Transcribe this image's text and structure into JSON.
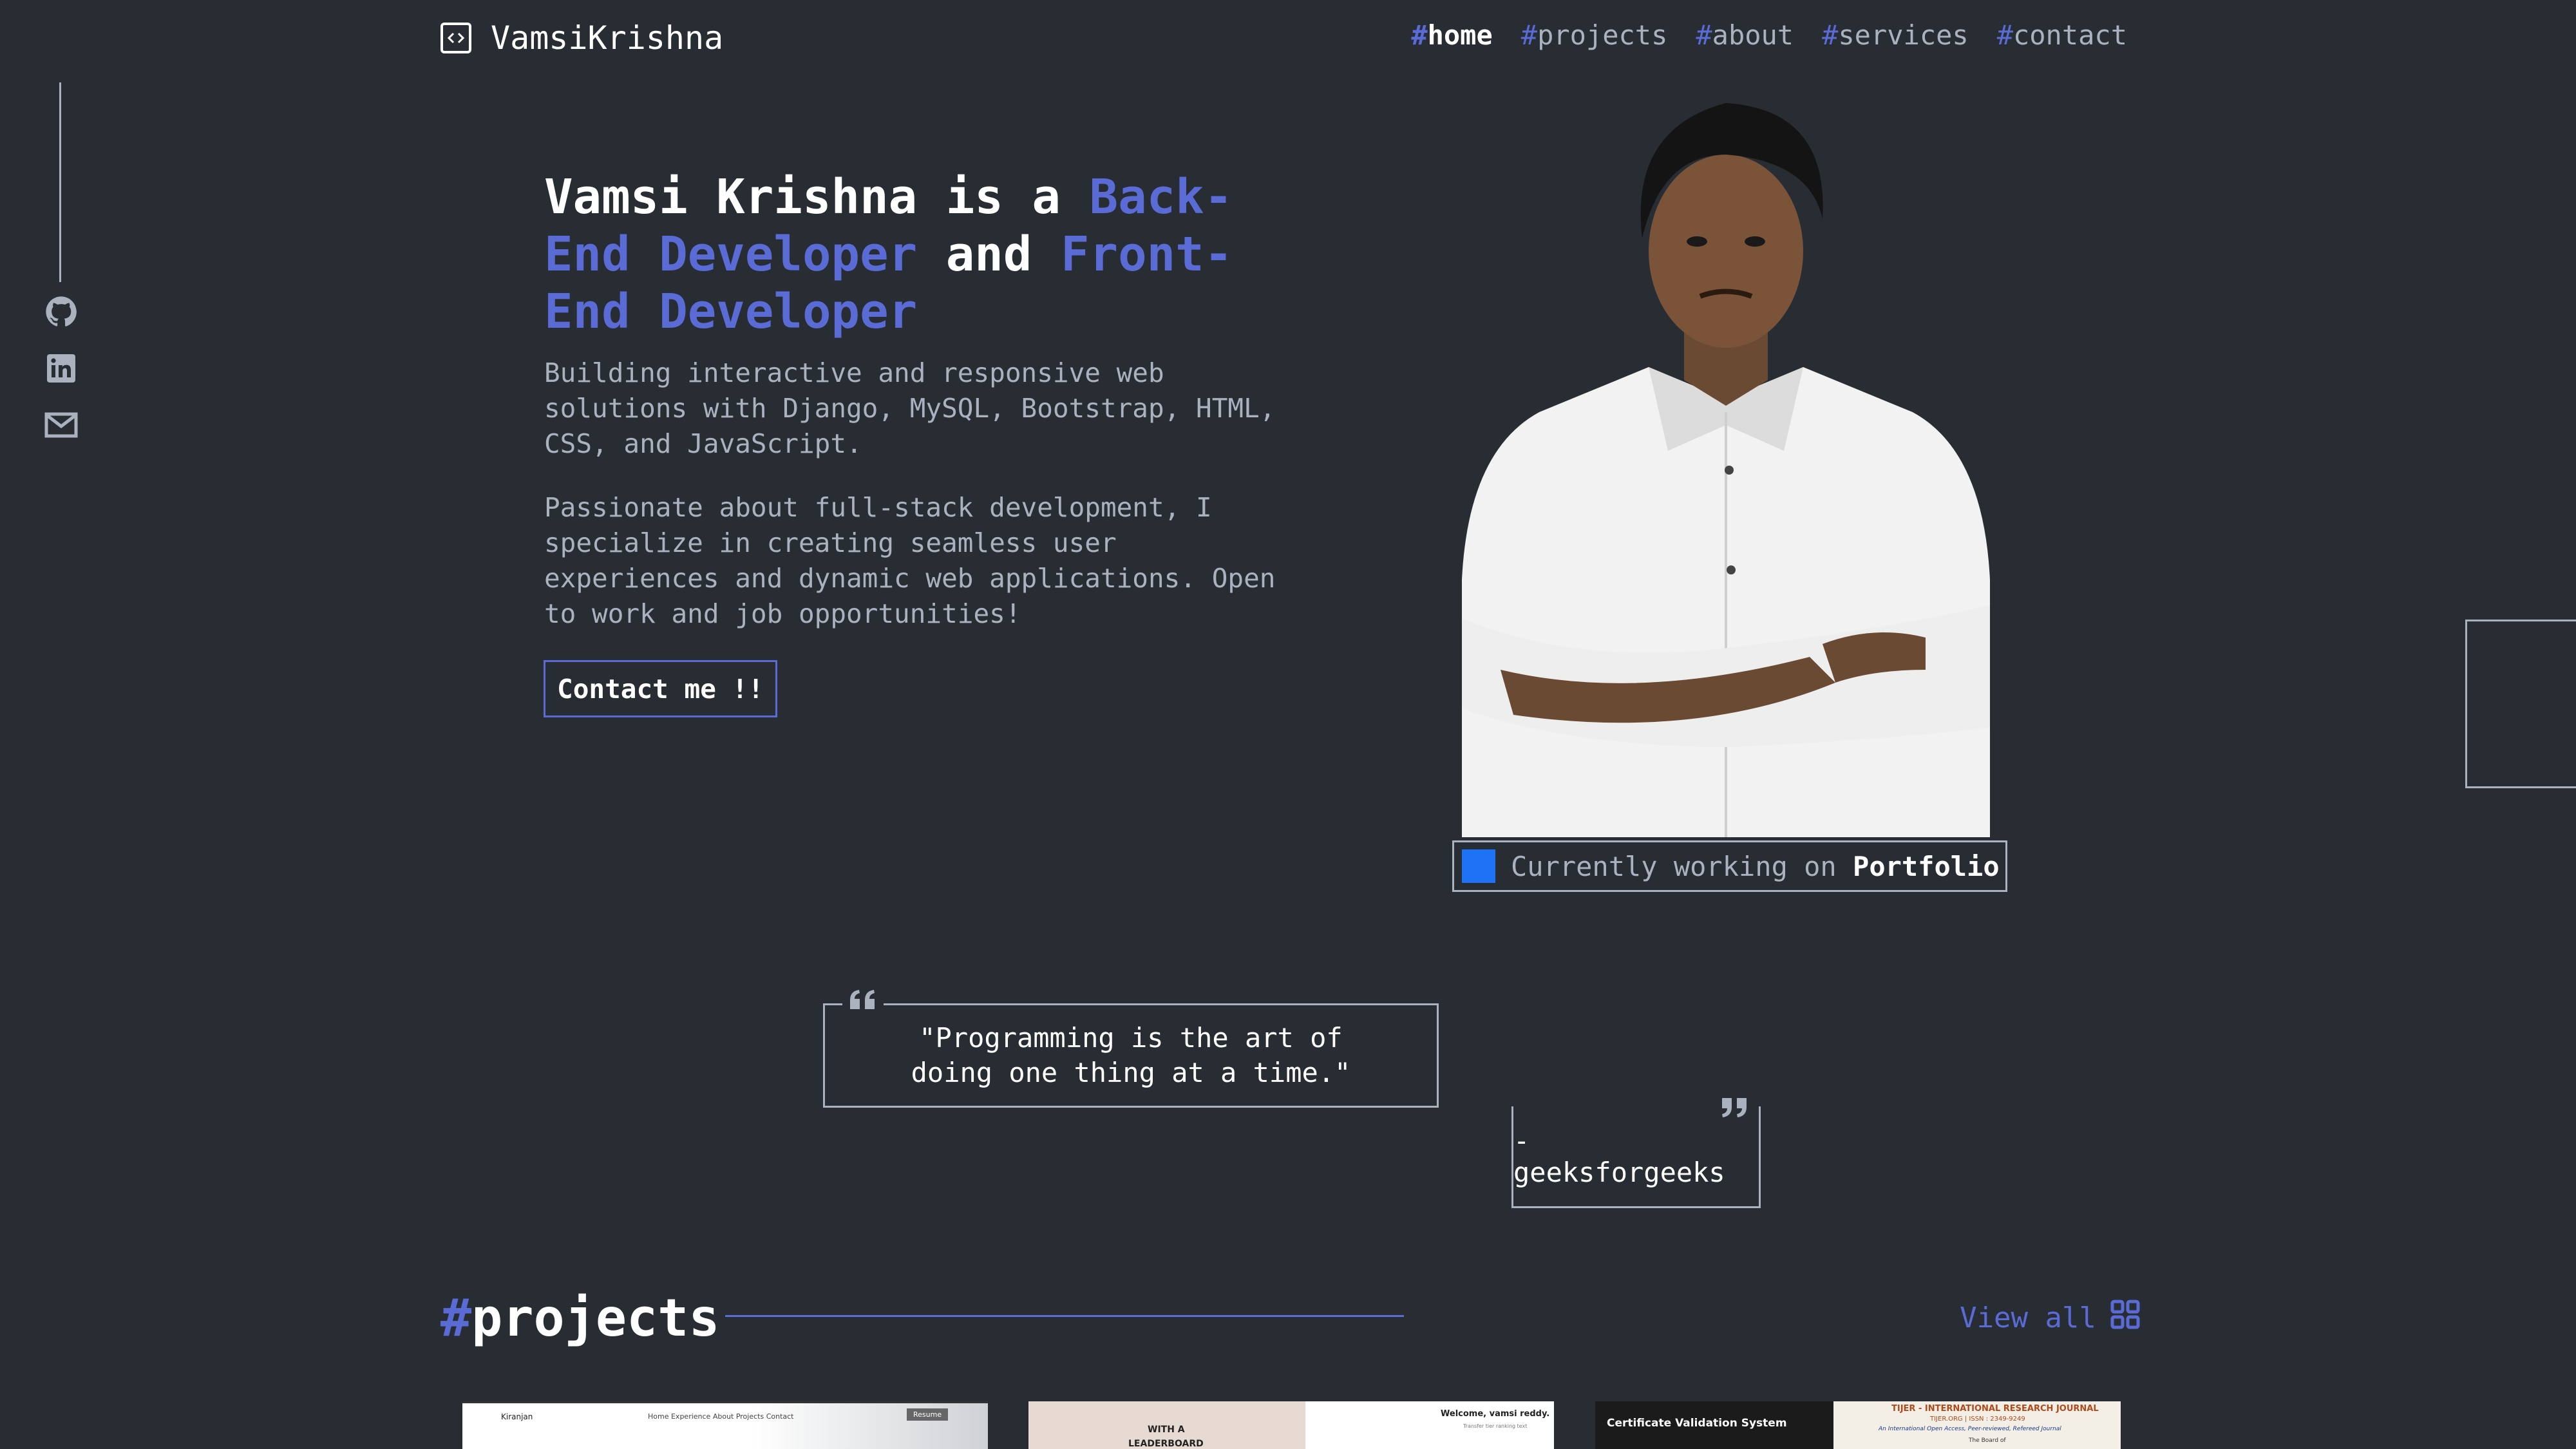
{
  "header": {
    "logo_text": "VamsiKrishna",
    "nav": [
      {
        "hash": "#",
        "label": "home",
        "active": true
      },
      {
        "hash": "#",
        "label": "projects"
      },
      {
        "hash": "#",
        "label": "about"
      },
      {
        "hash": "#",
        "label": "services"
      },
      {
        "hash": "#",
        "label": "contact"
      }
    ]
  },
  "socials": [
    "github-icon",
    "linkedin-icon",
    "mail-icon"
  ],
  "hero": {
    "name": "Vamsi Krishna",
    "is_a": "is a",
    "role1": "Back-End Developer",
    "and": "and",
    "role2": "Front-End Developer",
    "para1": "Building interactive and responsive web solutions with Django, MySQL, Bootstrap, HTML, CSS, and JavaScript.",
    "para2": "Passionate about full-stack development, I specialize in creating seamless user experiences and dynamic web applications. Open to work and job opportunities!",
    "contact_button": "Contact me !!",
    "status_prefix": "Currently working on",
    "status_project": "Portfolio"
  },
  "quote": {
    "text": "\"Programming is the art of doing one thing at a time.\"",
    "author": "- geeksforgeeks"
  },
  "projects": {
    "hash": "#",
    "title": "projects",
    "view_all": "View all",
    "thumbs": [
      {
        "brand": "Kiranjan",
        "nav": "Home  Experience  About  Projects  Contact",
        "badge": "Resume"
      },
      {
        "line1": "WITH A",
        "line2": "LEADERBOARD",
        "welcome": "Welcome, vamsi reddy.",
        "sub": "Transfer tier ranking text"
      },
      {
        "title": "Certificate Validation System",
        "journal": "TIJER - INTERNATIONAL RESEARCH JOURNAL",
        "journal_sub": "TIJER.ORG | ISSN : 2349-9249",
        "journal_sub2": "An International Open Access, Peer-reviewed, Refereed Journal",
        "journal_sub3": "The Board of"
      }
    ]
  },
  "colors": {
    "background": "#282c33",
    "accent": "#5b6bd6",
    "muted": "#abb2bf",
    "status_square": "#1e72f5"
  }
}
